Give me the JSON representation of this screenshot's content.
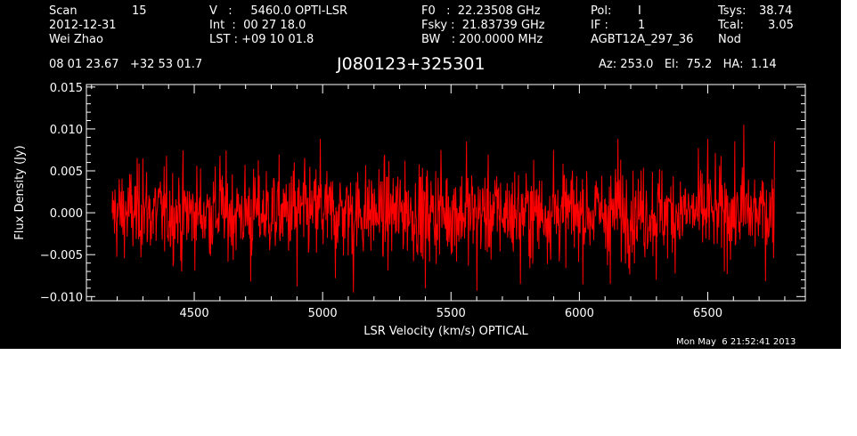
{
  "header": {
    "scan_label": "Scan",
    "scan_value": "15",
    "date": "2012-12-31",
    "observer": "Wei Zhao",
    "v_line": "V   :     5460.0 OPTI-LSR",
    "int_line": "Int  :  00 27 18.0",
    "lst_line": "LST : +09 10 01.8",
    "f0_line": "F0   :  22.23508 GHz",
    "fsky_line": "Fsky :  21.83739 GHz",
    "bw_line": "BW   : 200.0000 MHz",
    "pol_label": "Pol:",
    "pol_value": "I",
    "if_label": "IF :",
    "if_value": "1",
    "project": "AGBT12A_297_36",
    "tsys_label": "Tsys:",
    "tsys_value": "38.74",
    "tcal_label": "Tcal:",
    "tcal_value": "3.05",
    "mode": "Nod",
    "coords": "08 01 23.67   +32 53 01.7",
    "source": "J080123+325301",
    "az_el_ha": "Az: 253.0   El:  75.2   HA:  1.14",
    "timestamp": "Mon May  6 21:52:41 2013"
  },
  "colors": {
    "background": "#000000",
    "axes": "#ffffff",
    "spectrum": "#ff0000"
  },
  "chart_data": {
    "type": "line",
    "xlabel": "LSR Velocity (km/s) OPTICAL",
    "ylabel": "Flux Density (Jy)",
    "xlim": [
      4080,
      6880
    ],
    "ylim": [
      -0.0105,
      0.0153
    ],
    "xticks": [
      "4500",
      "5000",
      "5500",
      "6000",
      "6500"
    ],
    "yticks": [
      "−0.010",
      "−0.005",
      "0.000",
      "0.005",
      "0.010",
      "0.015"
    ],
    "series": [
      {
        "x_start": 4180,
        "x_end": 6760,
        "sampled_points": [
          [
            4180,
            0.0
          ],
          [
            4300,
            0.0065
          ],
          [
            4450,
            -0.007
          ],
          [
            4600,
            0.0068
          ],
          [
            4720,
            -0.0082
          ],
          [
            4890,
            0.006
          ],
          [
            4900,
            -0.0088
          ],
          [
            4990,
            0.0088
          ],
          [
            5050,
            -0.0078
          ],
          [
            5120,
            -0.0095
          ],
          [
            5320,
            0.0062
          ],
          [
            5400,
            -0.009
          ],
          [
            5460,
            0.0075
          ],
          [
            5560,
            0.0085
          ],
          [
            5600,
            -0.0093
          ],
          [
            5770,
            -0.0085
          ],
          [
            5900,
            0.0075
          ],
          [
            6120,
            -0.0085
          ],
          [
            6150,
            0.0088
          ],
          [
            6300,
            -0.008
          ],
          [
            6500,
            0.0088
          ],
          [
            6640,
            0.0105
          ],
          [
            6760,
            0.0085
          ]
        ],
        "rms_noise": 0.0027
      }
    ],
    "grid": false
  }
}
